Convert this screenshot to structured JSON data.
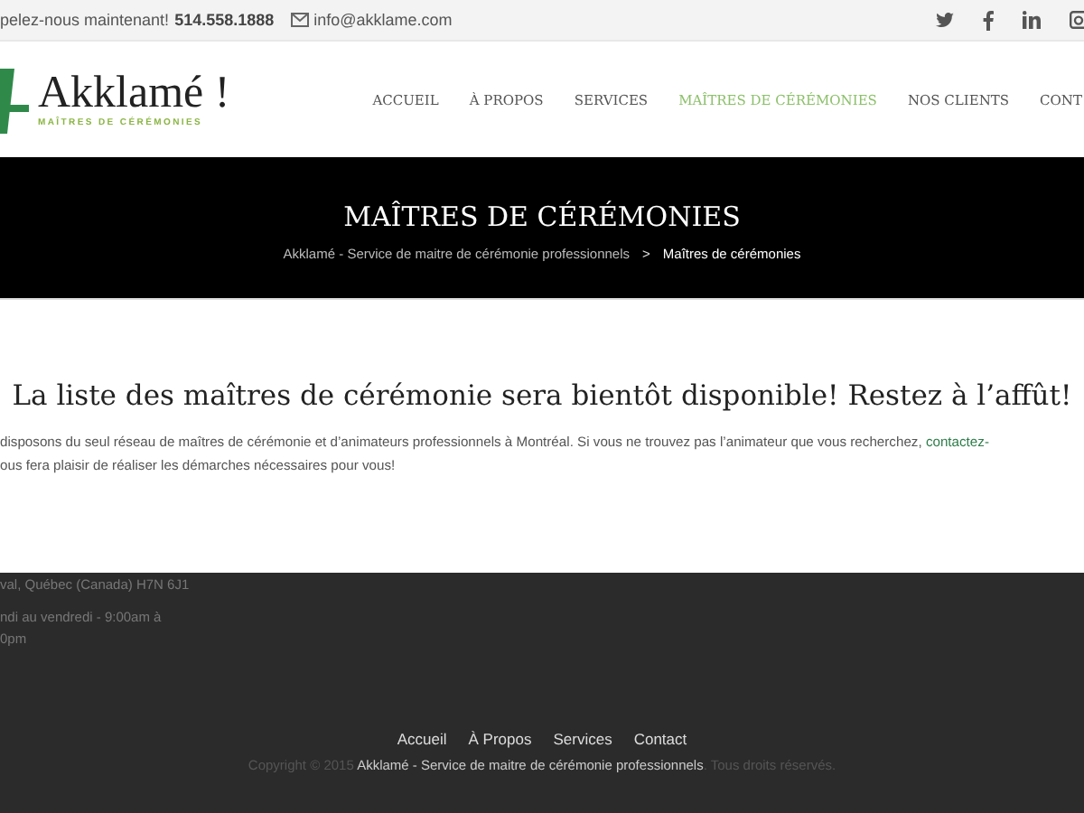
{
  "top_bar": {
    "call_text": "pelez-nous maintenant!",
    "phone": "514.558.1888",
    "email": "info@akklame.com",
    "social": [
      {
        "kind": "twitter"
      },
      {
        "kind": "facebook"
      },
      {
        "kind": "linkedin"
      },
      {
        "kind": "instagram"
      }
    ]
  },
  "header": {
    "logo_name": "Akklamé !",
    "logo_tagline": "MAÎTRES DE CÉRÉMONIES",
    "nav": [
      {
        "label": "ACCUEIL",
        "selected": false
      },
      {
        "label": "À PROPOS",
        "selected": false
      },
      {
        "label": "SERVICES",
        "selected": false
      },
      {
        "label": "MAÎTRES DE CÉRÉMONIES",
        "selected": true
      },
      {
        "label": "NOS CLIENTS",
        "selected": false
      },
      {
        "label": "CONT",
        "selected": false
      }
    ]
  },
  "banner": {
    "title": "MAÎTRES DE CÉRÉMONIES",
    "breadcrumb": [
      {
        "label": "Akklamé - Service de maitre de cérémonie professionnels",
        "current": false
      },
      {
        "label": "Maîtres de cérémonies",
        "current": true
      }
    ],
    "separator": ">"
  },
  "content": {
    "heading": "La liste des maîtres de cérémonie sera bientôt disponible! Restez à l’affût!",
    "line_1": "disposons du seul réseau de maîtres de cérémonie et d’animateurs professionnels à Montréal. Si vous ne trouvez pas l’animateur que vous recherchez,",
    "link": "contactez-",
    "line_2": "ous fera plaisir de réaliser les démarches nécessaires pour vous!"
  },
  "footer": {
    "address": "val, Québec (Canada) H7N 6J1",
    "hours": [
      "ndi au vendredi - 9:00am à",
      "0pm"
    ],
    "links": [
      "Accueil",
      "À Propos",
      "Services",
      "Contact"
    ],
    "copyright_before": "Copyright © 2015",
    "copyright_name": "Akklamé - Service de maitre de cérémonie professionnels",
    "copyright_after": ". Tous droits réservés."
  }
}
